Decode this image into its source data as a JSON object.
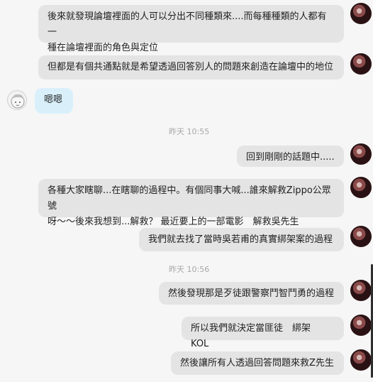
{
  "messages": [
    {
      "text": "後來就發現論壇裡面的人可以分出不同種類來....而每種種類的人都有一\n種在論壇裡面的角色與定位"
    },
    {
      "text": "但都是有個共通點就是希望透過回答別人的問題來創造在論壇中的地位"
    },
    {
      "text": "嗯嗯"
    },
    {
      "text": "回到剛剛的話題中....."
    },
    {
      "text": "各種大家瞎聊...在瞎聊的過程中。有個同事大喊...誰來解救Zippo公眾號\n呀～～後來我想到...解救？ 最近要上的一部電影　解救吳先生"
    },
    {
      "text": "我們就去找了當時吳若甫的真實綁架案的過程"
    },
    {
      "text": "然後發現那是歹徒跟警察鬥智鬥勇的過程"
    },
    {
      "text": "所以我們就決定當匪徒　綁架　KOL"
    },
    {
      "text": "然後讓所有人透過回答問題來救Z先生"
    }
  ],
  "timestamps": [
    "昨天  10:55",
    "昨天  10:56"
  ],
  "colors": {
    "outgoing_bubble": "#e4e4e4",
    "incoming_bubble": "#d9f0fb",
    "background": "#f6f6f6"
  }
}
